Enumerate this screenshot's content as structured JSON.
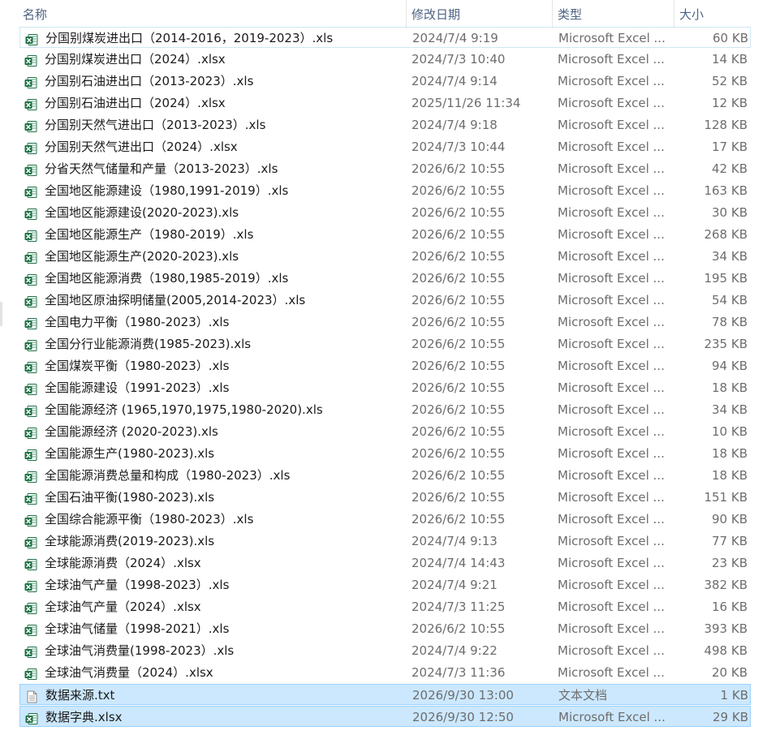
{
  "header": {
    "name": "名称",
    "date": "修改日期",
    "type": "类型",
    "size": "大小",
    "sort_arrow": "^"
  },
  "files": [
    {
      "name": "分国别煤炭进出口（2014-2016，2019-2023）.xls",
      "date": "2024/7/4 9:19",
      "type": "Microsoft Excel ...",
      "size": "60 KB",
      "icon": "excel-icon"
    },
    {
      "name": "分国别煤炭进出口（2024）.xlsx",
      "date": "2024/7/3 10:40",
      "type": "Microsoft Excel ...",
      "size": "14 KB",
      "icon": "excel-icon"
    },
    {
      "name": "分国别石油进出口（2013-2023）.xls",
      "date": "2024/7/4 9:14",
      "type": "Microsoft Excel ...",
      "size": "52 KB",
      "icon": "excel-icon"
    },
    {
      "name": "分国别石油进出口（2024）.xlsx",
      "date": "2025/11/26 11:34",
      "type": "Microsoft Excel ...",
      "size": "12 KB",
      "icon": "excel-icon"
    },
    {
      "name": "分国别天然气进出口（2013-2023）.xls",
      "date": "2024/7/4 9:18",
      "type": "Microsoft Excel ...",
      "size": "128 KB",
      "icon": "excel-icon"
    },
    {
      "name": "分国别天然气进出口（2024）.xlsx",
      "date": "2024/7/3 10:44",
      "type": "Microsoft Excel ...",
      "size": "17 KB",
      "icon": "excel-icon"
    },
    {
      "name": "分省天然气储量和产量（2013-2023）.xls",
      "date": "2026/6/2 10:55",
      "type": "Microsoft Excel ...",
      "size": "42 KB",
      "icon": "excel-icon"
    },
    {
      "name": "全国地区能源建设（1980,1991-2019）.xls",
      "date": "2026/6/2 10:55",
      "type": "Microsoft Excel ...",
      "size": "163 KB",
      "icon": "excel-icon"
    },
    {
      "name": "全国地区能源建设(2020-2023).xls",
      "date": "2026/6/2 10:55",
      "type": "Microsoft Excel ...",
      "size": "30 KB",
      "icon": "excel-icon"
    },
    {
      "name": "全国地区能源生产（1980-2019）.xls",
      "date": "2026/6/2 10:55",
      "type": "Microsoft Excel ...",
      "size": "268 KB",
      "icon": "excel-icon"
    },
    {
      "name": "全国地区能源生产(2020-2023).xls",
      "date": "2026/6/2 10:55",
      "type": "Microsoft Excel ...",
      "size": "34 KB",
      "icon": "excel-icon"
    },
    {
      "name": "全国地区能源消费（1980,1985-2019）.xls",
      "date": "2026/6/2 10:55",
      "type": "Microsoft Excel ...",
      "size": "195 KB",
      "icon": "excel-icon"
    },
    {
      "name": "全国地区原油探明储量(2005,2014-2023）.xls",
      "date": "2026/6/2 10:55",
      "type": "Microsoft Excel ...",
      "size": "54 KB",
      "icon": "excel-icon"
    },
    {
      "name": "全国电力平衡（1980-2023）.xls",
      "date": "2026/6/2 10:55",
      "type": "Microsoft Excel ...",
      "size": "78 KB",
      "icon": "excel-icon"
    },
    {
      "name": "全国分行业能源消费(1985-2023).xls",
      "date": "2026/6/2 10:55",
      "type": "Microsoft Excel ...",
      "size": "235 KB",
      "icon": "excel-icon"
    },
    {
      "name": "全国煤炭平衡（1980-2023）.xls",
      "date": "2026/6/2 10:55",
      "type": "Microsoft Excel ...",
      "size": "94 KB",
      "icon": "excel-icon"
    },
    {
      "name": "全国能源建设（1991-2023）.xls",
      "date": "2026/6/2 10:55",
      "type": "Microsoft Excel ...",
      "size": "18 KB",
      "icon": "excel-icon"
    },
    {
      "name": "全国能源经济 (1965,1970,1975,1980-2020).xls",
      "date": "2026/6/2 10:55",
      "type": "Microsoft Excel ...",
      "size": "34 KB",
      "icon": "excel-icon"
    },
    {
      "name": "全国能源经济 (2020-2023).xls",
      "date": "2026/6/2 10:55",
      "type": "Microsoft Excel ...",
      "size": "10 KB",
      "icon": "excel-icon"
    },
    {
      "name": "全国能源生产(1980-2023).xls",
      "date": "2026/6/2 10:55",
      "type": "Microsoft Excel ...",
      "size": "18 KB",
      "icon": "excel-icon"
    },
    {
      "name": "全国能源消费总量和构成（1980-2023）.xls",
      "date": "2026/6/2 10:55",
      "type": "Microsoft Excel ...",
      "size": "18 KB",
      "icon": "excel-icon"
    },
    {
      "name": "全国石油平衡(1980-2023).xls",
      "date": "2026/6/2 10:55",
      "type": "Microsoft Excel ...",
      "size": "151 KB",
      "icon": "excel-icon"
    },
    {
      "name": "全国综合能源平衡（1980-2023）.xls",
      "date": "2026/6/2 10:55",
      "type": "Microsoft Excel ...",
      "size": "90 KB",
      "icon": "excel-icon"
    },
    {
      "name": "全球能源消费(2019-2023).xls",
      "date": "2024/7/4 9:13",
      "type": "Microsoft Excel ...",
      "size": "77 KB",
      "icon": "excel-icon"
    },
    {
      "name": "全球能源消费（2024）.xlsx",
      "date": "2024/7/4 14:43",
      "type": "Microsoft Excel ...",
      "size": "23 KB",
      "icon": "excel-icon"
    },
    {
      "name": "全球油气产量（1998-2023）.xls",
      "date": "2024/7/4 9:21",
      "type": "Microsoft Excel ...",
      "size": "382 KB",
      "icon": "excel-icon"
    },
    {
      "name": "全球油气产量（2024）.xlsx",
      "date": "2024/7/3 11:25",
      "type": "Microsoft Excel ...",
      "size": "16 KB",
      "icon": "excel-icon"
    },
    {
      "name": "全球油气储量（1998-2021）.xls",
      "date": "2026/6/2 10:55",
      "type": "Microsoft Excel ...",
      "size": "393 KB",
      "icon": "excel-icon"
    },
    {
      "name": "全球油气消费量(1998-2023）.xls",
      "date": "2024/7/4 9:22",
      "type": "Microsoft Excel ...",
      "size": "498 KB",
      "icon": "excel-icon"
    },
    {
      "name": "全球油气消费量（2024）.xlsx",
      "date": "2024/7/3 11:36",
      "type": "Microsoft Excel ...",
      "size": "20 KB",
      "icon": "excel-icon"
    },
    {
      "name": "数据来源.txt",
      "date": "2026/9/30 13:00",
      "type": "文本文档",
      "size": "1 KB",
      "icon": "text-file-icon"
    },
    {
      "name": "数据字典.xlsx",
      "date": "2026/9/30 12:50",
      "type": "Microsoft Excel ...",
      "size": "29 KB",
      "icon": "excel-icon"
    }
  ],
  "focused_index": 0,
  "selected_indices": [
    30,
    31
  ],
  "colors": {
    "header_text": "#4d6282",
    "selection_fill": "#cce8ff",
    "selection_border": "#99d1ff",
    "excel_green": "#1e7145"
  }
}
